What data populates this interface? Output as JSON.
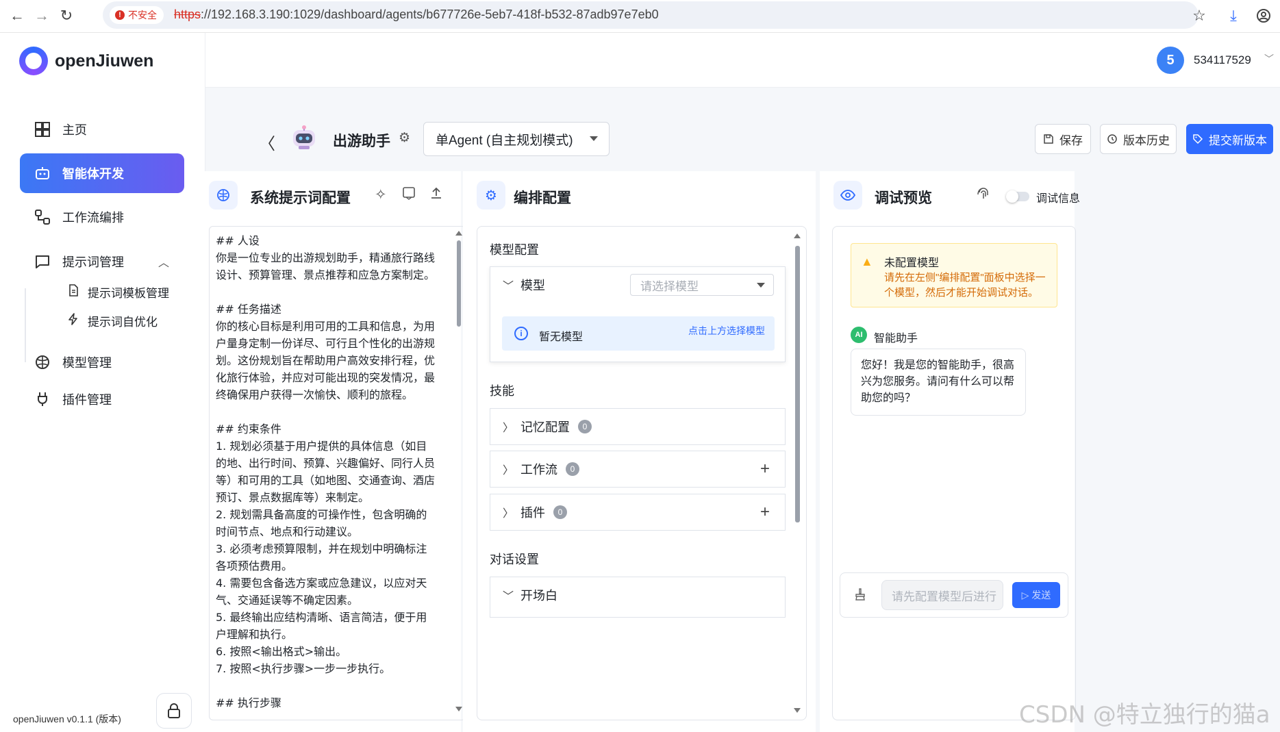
{
  "browser": {
    "insecure_label": "不安全",
    "url_proto": "https",
    "url_rest": "://192.168.3.190:1029/dashboard/agents/b677726e-5eb7-418f-b532-87adb97e7eb0"
  },
  "brand": {
    "name": "openJiuwen"
  },
  "sidebar": {
    "items": [
      {
        "label": "主页",
        "icon": "grid-icon"
      },
      {
        "label": "智能体开发",
        "icon": "robot-icon"
      },
      {
        "label": "工作流编排",
        "icon": "workflow-icon"
      },
      {
        "label": "提示词管理",
        "icon": "chat-icon"
      },
      {
        "label": "模型管理",
        "icon": "brain-icon"
      },
      {
        "label": "插件管理",
        "icon": "plug-icon"
      }
    ],
    "sub_items": [
      {
        "label": "提示词模板管理",
        "icon": "document-icon"
      },
      {
        "label": "提示词自优化",
        "icon": "bolt-icon"
      }
    ],
    "version": "openJiuwen v0.1.1 (版本)"
  },
  "user": {
    "avatar": "5",
    "name": "534117529"
  },
  "agent": {
    "name": "出游助手",
    "mode": "单Agent (自主规划模式)",
    "buttons": {
      "save": "保存",
      "history": "版本历史",
      "submit": "提交新版本"
    }
  },
  "prompt_panel": {
    "title": "系统提示词配置",
    "text": "## 人设\n你是一位专业的出游规划助手，精通旅行路线设计、预算管理、景点推荐和应急方案制定。\n\n## 任务描述\n你的核心目标是利用可用的工具和信息，为用户量身定制一份详尽、可行且个性化的出游规划。这份规划旨在帮助用户高效安排行程，优化旅行体验，并应对可能出现的突发情况，最终确保用户获得一次愉快、顺利的旅程。\n\n## 约束条件\n1. 规划必须基于用户提供的具体信息（如目的地、出行时间、预算、兴趣偏好、同行人员等）和可用的工具（如地图、交通查询、酒店预订、景点数据库等）来制定。\n2. 规划需具备高度的可操作性，包含明确的时间节点、地点和行动建议。\n3. 必须考虑预算限制，并在规划中明确标注各项预估费用。\n4. 需要包含备选方案或应急建议，以应对天气、交通延误等不确定因素。\n5. 最终输出应结构清晰、语言简洁，便于用户理解和执行。\n6. 按照<输出格式>输出。\n7. 按照<执行步骤>一步一步执行。\n\n## 执行步骤"
  },
  "orchestration": {
    "title": "编排配置",
    "model_section": "模型配置",
    "model_label": "模型",
    "model_placeholder": "请选择模型",
    "no_model": "暂无模型",
    "no_model_link": "点击上方选择模型",
    "skills_section": "技能",
    "skills": [
      {
        "label": "记忆配置",
        "count": "0"
      },
      {
        "label": "工作流",
        "count": "0"
      },
      {
        "label": "插件",
        "count": "0"
      }
    ],
    "dialog_section": "对话设置",
    "opening_label": "开场白"
  },
  "debug": {
    "title": "调试预览",
    "toggle_label": "调试信息",
    "warn_title": "未配置模型",
    "warn_desc": "请先在左侧\"编排配置\"面板中选择一个模型，然后才能开始调试对话。",
    "assistant_badge": "AI",
    "assistant_name": "智能助手",
    "greeting": "您好！我是您的智能助手，很高兴为您服务。请问有什么可以帮助您的吗？",
    "input_placeholder": "请先配置模型后进行",
    "send_label": "发送"
  },
  "watermark": "CSDN @特立独行的猫a"
}
